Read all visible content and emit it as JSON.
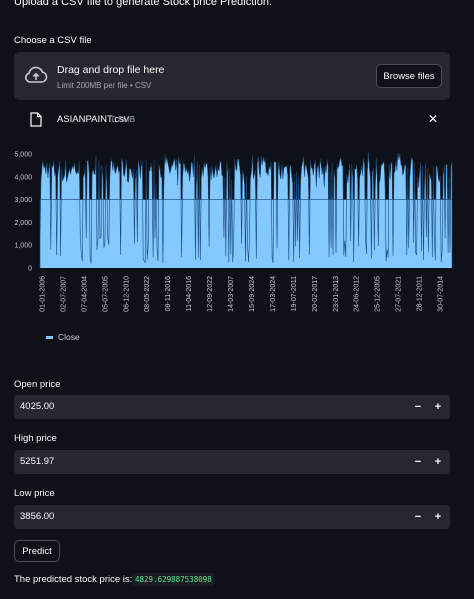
{
  "intro_text": "Upload a CSV file to generate Stock price Prediction.",
  "uploader": {
    "label": "Choose a CSV file",
    "drop_title": "Drag and drop file here",
    "drop_subtitle": "Limit 200MB per file • CSV",
    "browse_label": "Browse files",
    "file_name": "ASIANPAINT.csv",
    "file_size": "0.5MB"
  },
  "colors": {
    "background": "#0e1117",
    "surface": "#262730",
    "series": "#83c9ff",
    "result": "#5ce488"
  },
  "chart_data": {
    "type": "area",
    "title": "",
    "xlabel": "",
    "ylabel": "",
    "ylim": [
      0,
      5000
    ],
    "yticks": [
      "0",
      "1,000",
      "2,000",
      "3,000",
      "4,000",
      "5,000"
    ],
    "xticks": [
      "01-01-2006",
      "02-07-2007",
      "07-04-2004",
      "05-07-2005",
      "06-12-2010",
      "08-05-2022",
      "09-11-2016",
      "11-04-2016",
      "12-09-2022",
      "14-03-2007",
      "15-09-2024",
      "17-03-2024",
      "19-07-2011",
      "20-02-2017",
      "23-01-2013",
      "24-06-2012",
      "25-12-2005",
      "27-07-2021",
      "28-12-2011",
      "30-07-2014"
    ],
    "legend": "bottom-left",
    "series": [
      {
        "name": "Close",
        "baseline": 3000,
        "min": 200,
        "max": 5100
      }
    ]
  },
  "form": {
    "open": {
      "label": "Open price",
      "value": "4025.00"
    },
    "high": {
      "label": "High price",
      "value": "5251.97"
    },
    "low": {
      "label": "Low price",
      "value": "3856.00"
    },
    "minus": "−",
    "plus": "+"
  },
  "predict_label": "Predict",
  "result": {
    "label": "The predicted stock price is:",
    "value": "4829.629887538098"
  }
}
